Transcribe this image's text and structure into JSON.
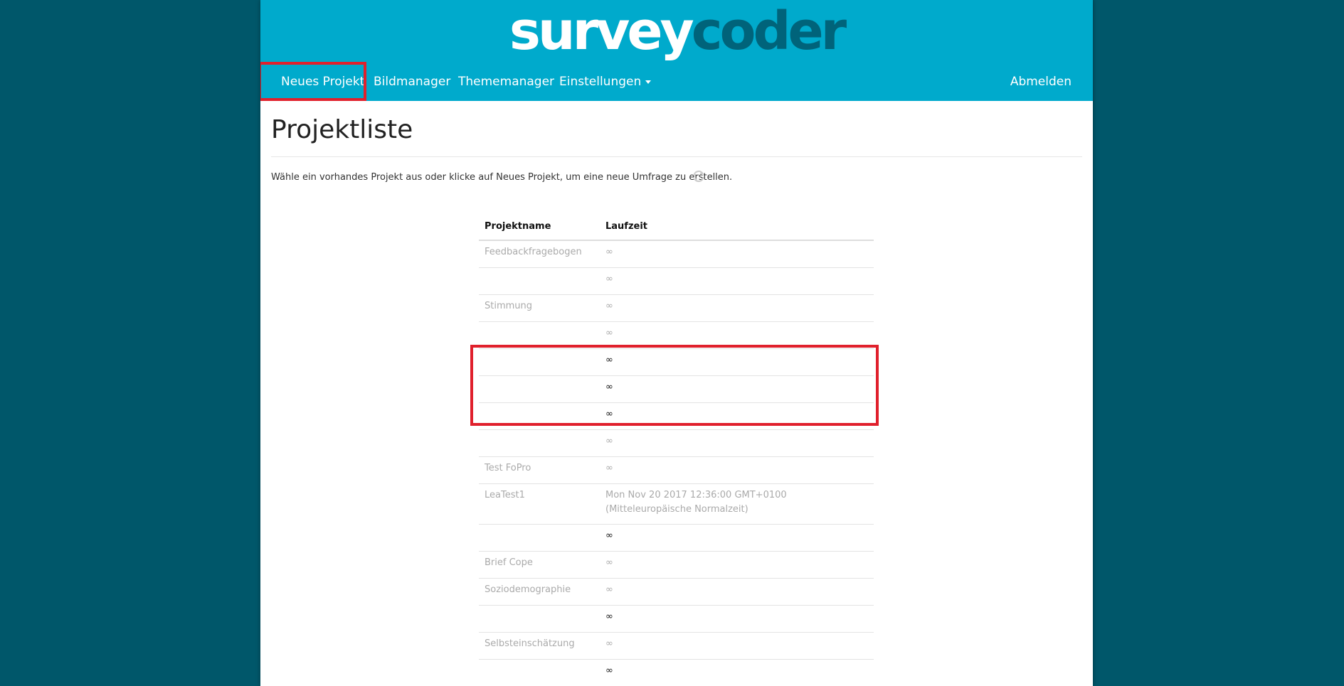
{
  "logo": {
    "part1": "survey",
    "part2": "coder"
  },
  "nav": {
    "new_project": "Neues Projekt",
    "image_manager": "Bildmanager",
    "theme_manager": "Thememanager",
    "settings": "Einstellungen",
    "logout": "Abmelden"
  },
  "page_title": "Projektliste",
  "intro_text": "Wähle ein vorhandes Projekt aus oder klicke auf Neues Projekt, um eine neue Umfrage zu erstellen.",
  "table": {
    "headers": [
      "Projektname",
      "Laufzeit"
    ],
    "rows": [
      {
        "name": "Feedbackfragebogen",
        "runtime": "∞"
      },
      {
        "name": "",
        "runtime": "∞"
      },
      {
        "name": "Stimmung",
        "runtime": "∞"
      },
      {
        "name": "",
        "runtime": "∞"
      },
      {
        "name": "",
        "runtime": "∞"
      },
      {
        "name": "",
        "runtime": "∞"
      },
      {
        "name": "",
        "runtime": "∞"
      },
      {
        "name": "",
        "runtime": "∞"
      },
      {
        "name": "Test FoPro",
        "runtime": "∞"
      },
      {
        "name": "LeaTest1",
        "runtime": "Mon Nov 20 2017 12:36:00 GMT+0100 (Mitteleuropäische Normalzeit)"
      },
      {
        "name": "",
        "runtime": "∞"
      },
      {
        "name": "Brief Cope",
        "runtime": "∞"
      },
      {
        "name": "Soziodemographie",
        "runtime": "∞"
      },
      {
        "name": "",
        "runtime": "∞"
      },
      {
        "name": "Selbsteinschätzung",
        "runtime": "∞"
      },
      {
        "name": "",
        "runtime": "∞"
      }
    ]
  },
  "colors": {
    "background": "#00576a",
    "header": "#00aacc",
    "logo_accent": "#00637a",
    "highlight": "#e0202c"
  }
}
